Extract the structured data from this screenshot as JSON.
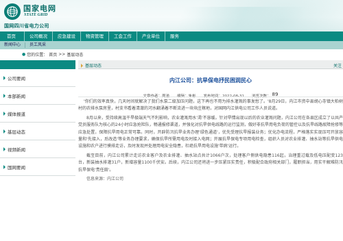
{
  "header": {
    "brand_cn": "国家电网",
    "brand_en": "STATE GRID",
    "brand_sub": "国网四川省电力公司",
    "logo_icon": "state-grid-logo"
  },
  "nav": {
    "items": [
      "首页",
      "公司概况",
      "应急建设",
      "物资管理",
      "工会工作",
      "产业单位",
      "服务"
    ]
  },
  "subnav": {
    "items": [
      "新闻中心",
      "员工风采"
    ]
  },
  "breadcrumb": {
    "pin_icon": "location-pin-icon",
    "label": "您的位置：",
    "home": "首页",
    "sep": ">>",
    "current": "基层动态"
  },
  "sidebar": {
    "items": [
      "公司要闻",
      "本部新闻",
      "媒体报道",
      "基层动态",
      "视频新闻",
      "国网要闻"
    ]
  },
  "main": {
    "tab_label": "基层动态",
    "tab_right": "关注",
    "article": {
      "title": "内江公司：抗旱保电抒民困润民心",
      "meta": "文章作者：周渝　　编辑：朱彬　　发布时间：2022-08-31　　浏览次数：",
      "views": "89",
      "paragraphs": [
        "'你们的效率真快，几天时间就解决了我们水泵二级加压问题，这下再也不用为排水灌溉的事发愁了。'8月29日，内江市资中县胡心寺镇大柏树村的农排水泵房里，村支书看着清澈的河水翻涌着不断流进一块块庄稼地，对国网内江供电公司工作人员说道。",
        "8月以来，受持续高温干旱极端天气不利影响，农业灌溉用水'渴'不容缓。针对旱情出现以后的农业灌溉问题，内江公司在各县区成立了以共产党员服务队为核心的24小时应急抢险队，畅通报修渠道，并强化对抗旱供电线路的运行监测，做好非抗旱用电负荷的管控以及抗旱线路故障抢修等应急处置，保障抗旱用电正常可靠。同时，开辟防汛抗旱业务办理'绿色通道'，优先受理抗旱报装业务；优化办电流程，严格落实实现压可开放容量和'先接入，后改造'等业务办理要求，确保抗旱所需用电及时接入电网；开展抗旱保电专项用电检查，组织人员对农业排灌、抽水站等抗旱供电设施和农户进行摸排走访，及时发现并处理用电安全隐患，杜绝抗旱用电设施'带病'运行。",
        "截至目前，内江公司累计走访农业客户及农业排灌、抽水站点共计1066户次，处理客户侧供电隐患116起，治理重过载及低电压配变123台，新装抽水排灌31户，新增容量1100千伏安。后续，内江公司还将进一步压紧压实责任，积极配合政府相关部门，履职担当，用实干解难防汛抗旱保电'责任田'。"
      ],
      "byline": "信息来源：内江公司"
    }
  },
  "colors": {
    "brand_green": "#0b8a82",
    "title_blue": "#1a4f9b",
    "subnav_bg": "#a9d3d0"
  }
}
